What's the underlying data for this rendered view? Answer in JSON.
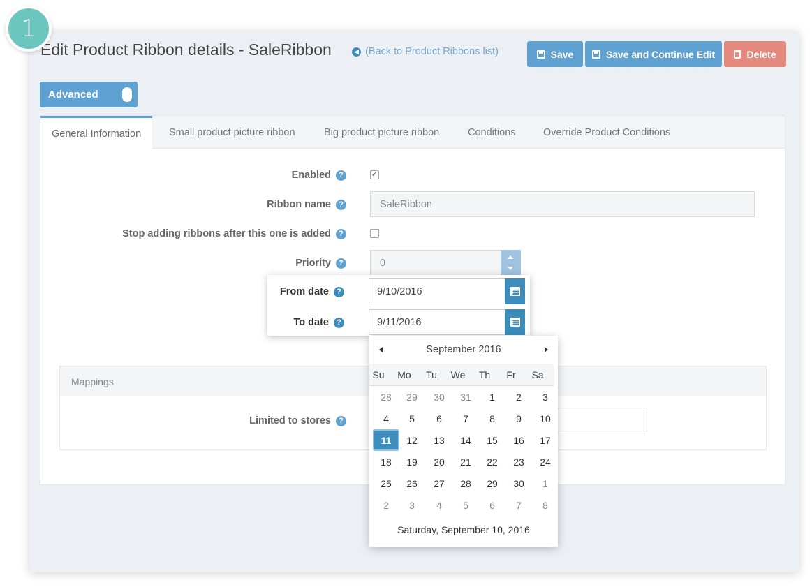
{
  "step_number": "1",
  "header": {
    "title": "Edit Product Ribbon details - SaleRibbon",
    "back_link": "(Back to Product Ribbons list)"
  },
  "toolbar": {
    "save_label": "Save",
    "save_continue_label": "Save and Continue Edit",
    "delete_label": "Delete"
  },
  "advanced_toggle": {
    "label": "Advanced",
    "on": true
  },
  "tabs": [
    {
      "label": "General Information",
      "active": true
    },
    {
      "label": "Small product picture ribbon",
      "active": false
    },
    {
      "label": "Big product picture ribbon",
      "active": false
    },
    {
      "label": "Conditions",
      "active": false
    },
    {
      "label": "Override Product Conditions",
      "active": false
    }
  ],
  "form": {
    "enabled_label": "Enabled",
    "enabled_checked": true,
    "ribbon_name_label": "Ribbon name",
    "ribbon_name_value": "SaleRibbon",
    "stop_label": "Stop adding ribbons after this one is added",
    "stop_checked": false,
    "priority_label": "Priority",
    "priority_value": "0",
    "from_date_label": "From date",
    "from_date_value": "9/10/2016",
    "to_date_label": "To date",
    "to_date_value": "9/11/2016"
  },
  "mappings": {
    "header": "Mappings",
    "limited_label": "Limited to stores"
  },
  "calendar": {
    "month_label": "September 2016",
    "days_of_week": [
      "Su",
      "Mo",
      "Tu",
      "We",
      "Th",
      "Fr",
      "Sa"
    ],
    "weeks": [
      [
        "28",
        "29",
        "30",
        "31",
        "1",
        "2",
        "3"
      ],
      [
        "4",
        "5",
        "6",
        "7",
        "8",
        "9",
        "10"
      ],
      [
        "11",
        "12",
        "13",
        "14",
        "15",
        "16",
        "17"
      ],
      [
        "18",
        "19",
        "20",
        "21",
        "22",
        "23",
        "24"
      ],
      [
        "25",
        "26",
        "27",
        "28",
        "29",
        "30",
        "1"
      ],
      [
        "2",
        "3",
        "4",
        "5",
        "6",
        "7",
        "8"
      ]
    ],
    "selected_day": "11",
    "footer": "Saturday, September 10, 2016"
  },
  "colors": {
    "primary": "#5fa2d1",
    "accent": "#3c8dbc",
    "danger": "#e4897d",
    "badge": "#6cc6c0"
  },
  "icons": {
    "save": "floppy-icon",
    "delete": "trash-icon",
    "back": "circle-arrow-left-icon",
    "help": "question-circle-icon",
    "calendar": "calendar-icon"
  }
}
